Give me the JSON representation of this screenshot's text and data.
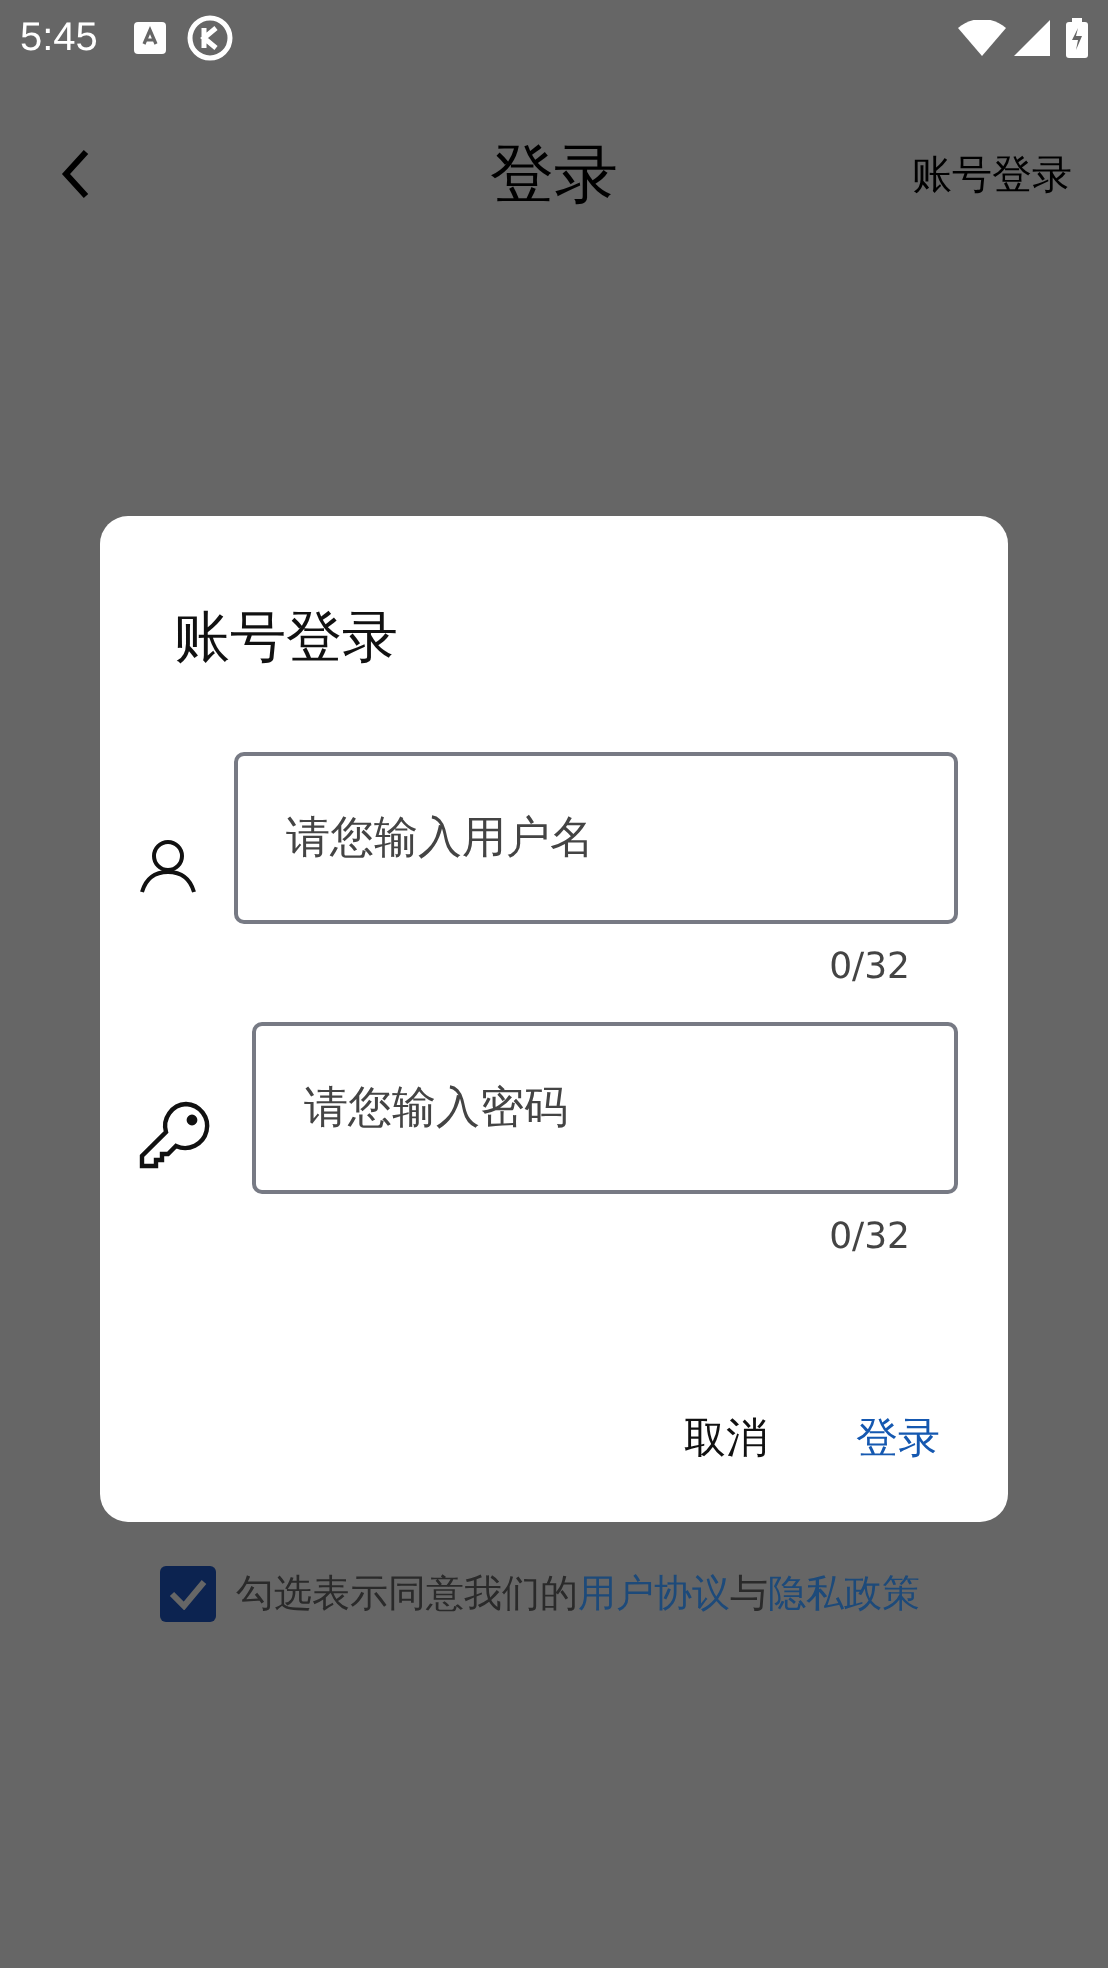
{
  "status_bar": {
    "time": "5:45"
  },
  "header": {
    "title": "登录",
    "action": "账号登录"
  },
  "dialog": {
    "title": "账号登录",
    "fields": [
      {
        "kind": "user",
        "placeholder": "请您输入用户名",
        "counter": "0/32"
      },
      {
        "kind": "key",
        "placeholder": "请您输入密码",
        "counter": "0/32"
      }
    ],
    "buttons": [
      {
        "label": "取消",
        "primary": false
      },
      {
        "label": "登录",
        "primary": true
      }
    ]
  },
  "agreement": {
    "checked": true,
    "parts": [
      {
        "text": "勾选表示同意我们的",
        "link": false
      },
      {
        "text": "用户协议",
        "link": true
      },
      {
        "text": "与",
        "link": false
      },
      {
        "text": "隐私政策",
        "link": true
      }
    ]
  }
}
